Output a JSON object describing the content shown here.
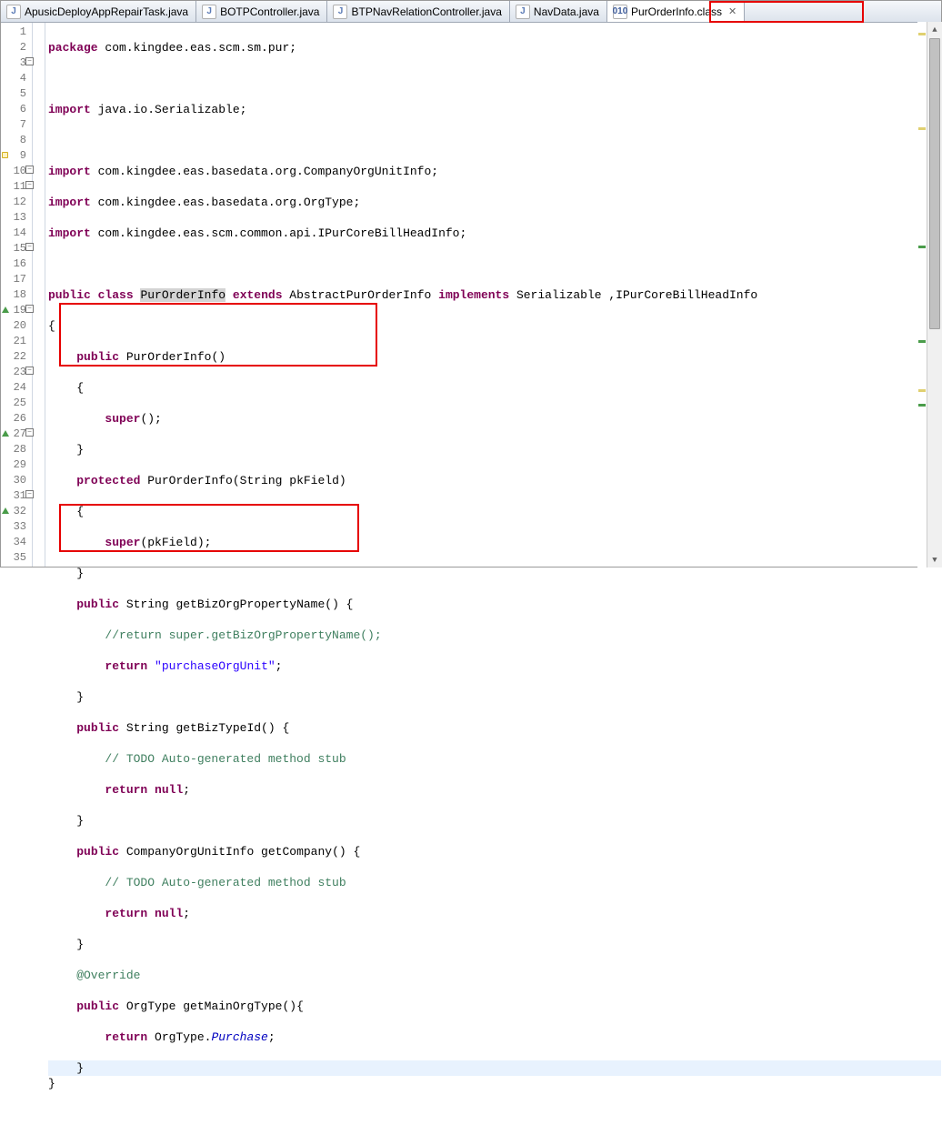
{
  "tabs": [
    {
      "label": "ApusicDeployAppRepairTask.java",
      "icon": "J",
      "type": "java"
    },
    {
      "label": "BOTPController.java",
      "icon": "J",
      "type": "java"
    },
    {
      "label": "BTPNavRelationController.java",
      "icon": "J",
      "type": "java"
    },
    {
      "label": "NavData.java",
      "icon": "J",
      "type": "java"
    },
    {
      "label": "PurOrderInfo.class",
      "icon": "010",
      "type": "class",
      "active": true,
      "closable": true
    }
  ],
  "code": {
    "l1": {
      "kw1": "package",
      "rest": " com.kingdee.eas.scm.sm.pur;"
    },
    "l2": "",
    "l3": {
      "kw1": "import",
      "rest": " java.io.Serializable;"
    },
    "l4": "",
    "l5": {
      "kw1": "import",
      "rest": " com.kingdee.eas.basedata.org.CompanyOrgUnitInfo;"
    },
    "l6": {
      "kw1": "import",
      "rest": " com.kingdee.eas.basedata.org.OrgType;"
    },
    "l7": {
      "kw1": "import",
      "rest": " com.kingdee.eas.scm.common.api.IPurCoreBillHeadInfo;"
    },
    "l8": "",
    "l9": {
      "kw1": "public",
      "kw2": "class",
      "hl": "PurOrderInfo",
      "kw3": "extends",
      "mid": " AbstractPurOrderInfo ",
      "kw4": "implements",
      "rest": " Serializable ,IPurCoreBillHeadInfo"
    },
    "l10": "{",
    "l11": {
      "kw1": "public",
      "rest": " PurOrderInfo()"
    },
    "l12": "    {",
    "l13": {
      "kw1": "super",
      "rest": "();"
    },
    "l14": "    }",
    "l15": {
      "kw1": "protected",
      "rest": " PurOrderInfo(String pkField)"
    },
    "l16": "    {",
    "l17": {
      "kw1": "super",
      "rest": "(pkField);"
    },
    "l18": "    }",
    "l19": {
      "kw1": "public",
      "rest": " String getBizOrgPropertyName() {"
    },
    "l20": "        //return super.getBizOrgPropertyName();",
    "l21": {
      "kw1": "return",
      "str": "\"purchaseOrgUnit\"",
      "rest": ";"
    },
    "l22": "    }",
    "l23": {
      "kw1": "public",
      "rest": " String getBizTypeId() {"
    },
    "l24": "        // TODO Auto-generated method stub",
    "l25": {
      "kw1": "return",
      "kw2": "null",
      "rest": ";"
    },
    "l26": "    }",
    "l27": {
      "kw1": "public",
      "rest": " CompanyOrgUnitInfo getCompany() {"
    },
    "l28": "        // TODO Auto-generated method stub",
    "l29": {
      "kw1": "return",
      "kw2": "null",
      "rest": ";"
    },
    "l30": "    }",
    "l31": "    @Override",
    "l32": {
      "kw1": "public",
      "rest": " OrgType getMainOrgType(){"
    },
    "l33": {
      "kw1": "return",
      "mid": " OrgType.",
      "fld": "Purchase",
      "rest": ";"
    },
    "l34": "    }",
    "l35": "}"
  },
  "line_numbers": [
    "1",
    "2",
    "3",
    "4",
    "5",
    "6",
    "7",
    "8",
    "9",
    "10",
    "11",
    "12",
    "13",
    "14",
    "15",
    "16",
    "17",
    "18",
    "19",
    "20",
    "21",
    "22",
    "23",
    "24",
    "25",
    "26",
    "27",
    "28",
    "29",
    "30",
    "31",
    "32",
    "33",
    "34",
    "35"
  ]
}
